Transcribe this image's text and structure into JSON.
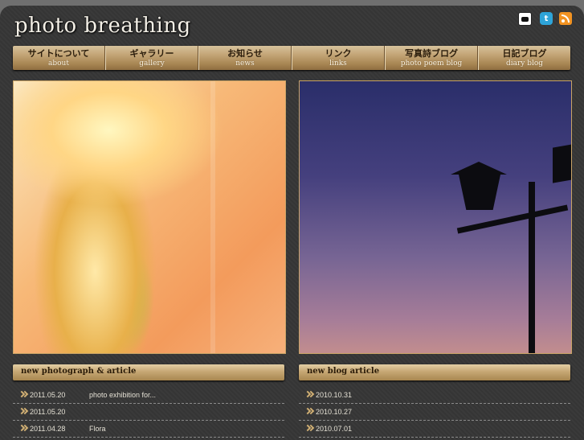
{
  "site": {
    "title": "photo breathing"
  },
  "icons": {
    "flickr": "flickr-icon",
    "twitter": "twitter-icon",
    "rss": "rss-icon",
    "twitter_glyph": "t"
  },
  "nav": [
    {
      "jp": "サイトについて",
      "en": "about"
    },
    {
      "jp": "ギャラリー",
      "en": "gallery"
    },
    {
      "jp": "お知らせ",
      "en": "news"
    },
    {
      "jp": "リンク",
      "en": "links"
    },
    {
      "jp": "写真詩ブログ",
      "en": "photo poem blog"
    },
    {
      "jp": "日記ブログ",
      "en": "diary blog"
    }
  ],
  "sections": {
    "left": {
      "title": "new photograph & article",
      "items": [
        {
          "date": "2011.05.20",
          "text": "photo exhibition for..."
        },
        {
          "date": "2011.05.20",
          "text": ""
        },
        {
          "date": "2011.04.28",
          "text": "Flora"
        }
      ]
    },
    "right": {
      "title": "new blog article",
      "items": [
        {
          "date": "2010.10.31",
          "text": ""
        },
        {
          "date": "2010.10.27",
          "text": ""
        },
        {
          "date": "2010.07.01",
          "text": ""
        }
      ]
    }
  },
  "colors": {
    "accent_gold": "#c6a774",
    "background": "#3a3a3a"
  }
}
